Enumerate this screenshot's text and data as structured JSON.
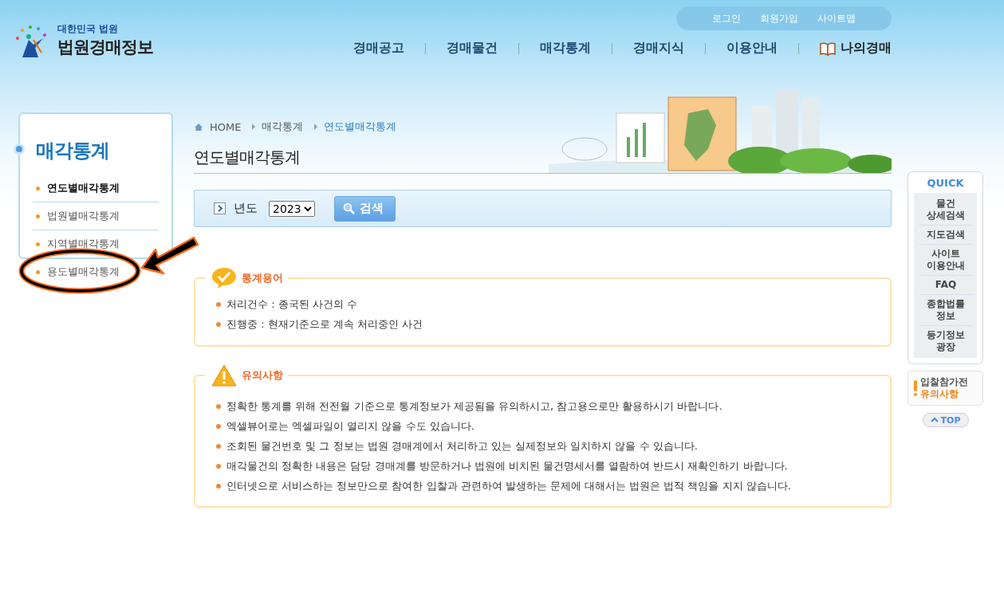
{
  "header": {
    "logo": {
      "subtitle": "대한민국 법원",
      "title": "법원경매정보"
    },
    "util_links": [
      "로그인",
      "회원가입",
      "사이트맵"
    ],
    "nav": [
      {
        "label": "경매공고",
        "kind": "plain"
      },
      {
        "label": "경매물건",
        "kind": "plain"
      },
      {
        "label": "매각통계",
        "kind": "plain"
      },
      {
        "label": "경매지식",
        "kind": "plain"
      },
      {
        "label": "이용안내",
        "kind": "plain"
      },
      {
        "label": "나의경매",
        "kind": "book"
      }
    ]
  },
  "sidebar": {
    "title": "매각통계",
    "items": [
      {
        "label": "연도별매각통계",
        "selected": true
      },
      {
        "label": "법원별매각통계",
        "selected": false
      },
      {
        "label": "지역별매각통계",
        "selected": false
      },
      {
        "label": "용도별매각통계",
        "selected": false
      }
    ]
  },
  "breadcrumb": [
    "HOME",
    "매각통계",
    "연도별매각통계"
  ],
  "page_title": "연도별매각통계",
  "search": {
    "label": "년도",
    "year": "2023",
    "button": "검색"
  },
  "terms": {
    "title": "통계용어",
    "items": [
      "처리건수 : 종국된 사건의 수",
      "진행중 : 현재기준으로 계속 처리중인 사건"
    ]
  },
  "notices": {
    "title": "유의사항",
    "items": [
      "정확한 통계를 위해 전전월 기준으로 통계정보가 제공됨을 유의하시고, 참고용으로만 활용하시기 바랍니다.",
      "엑셀뷰어로는 엑셀파일이 열리지 않을 수도 있습니다.",
      "조회된 물건번호 및 그 정보는 법원 경매계에서 처리하고 있는 실제정보와 일치하지 않을 수 있습니다.",
      "매각물건의 정확한 내용은 담당 경매계를 방문하거나 법원에 비치된 물건명세서를 열람하여 반드시 재확인하기 바랍니다.",
      "인터넷으로 서비스하는 정보만으로 참여한 입찰과 관련하여 발생하는 문제에 대해서는 법원은 법적 책임을 지지 않습니다."
    ]
  },
  "quick": {
    "title": "QUICK",
    "items": [
      "물건 상세검색",
      "지도검색",
      "사이트 이용안내",
      "FAQ",
      "종합법률 정보",
      "등기정보 광장"
    ]
  },
  "notice_box": {
    "line1": "입찰참가전",
    "line2": "유의사항"
  },
  "top_button": "TOP"
}
